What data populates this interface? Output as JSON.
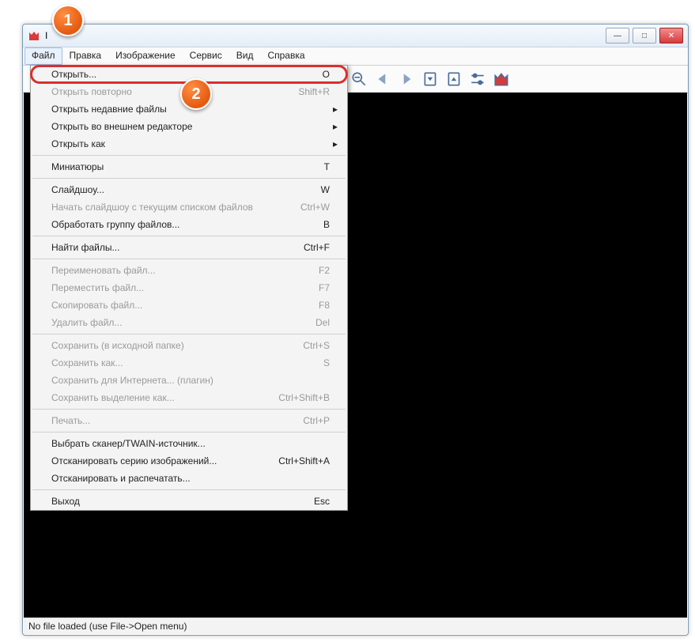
{
  "title": "I",
  "menubar": [
    "Файл",
    "Правка",
    "Изображение",
    "Сервис",
    "Вид",
    "Справка"
  ],
  "dropdown": {
    "groups": [
      [
        {
          "label": "Открыть...",
          "shortcut": "O",
          "disabled": false,
          "submenu": false,
          "highlight": true
        },
        {
          "label": "Открыть повторно",
          "shortcut": "Shift+R",
          "disabled": true,
          "submenu": false
        },
        {
          "label": "Открыть недавние файлы",
          "shortcut": "",
          "disabled": false,
          "submenu": true
        },
        {
          "label": "Открыть во внешнем редакторе",
          "shortcut": "",
          "disabled": false,
          "submenu": true
        },
        {
          "label": "Открыть как",
          "shortcut": "",
          "disabled": false,
          "submenu": true
        }
      ],
      [
        {
          "label": "Миниатюры",
          "shortcut": "T",
          "disabled": false,
          "submenu": false
        }
      ],
      [
        {
          "label": "Слайдшоу...",
          "shortcut": "W",
          "disabled": false,
          "submenu": false
        },
        {
          "label": "Начать слайдшоу с текущим списком файлов",
          "shortcut": "Ctrl+W",
          "disabled": true,
          "submenu": false
        },
        {
          "label": "Обработать группу файлов...",
          "shortcut": "B",
          "disabled": false,
          "submenu": false
        }
      ],
      [
        {
          "label": "Найти файлы...",
          "shortcut": "Ctrl+F",
          "disabled": false,
          "submenu": false
        }
      ],
      [
        {
          "label": "Переименовать файл...",
          "shortcut": "F2",
          "disabled": true,
          "submenu": false
        },
        {
          "label": "Переместить файл...",
          "shortcut": "F7",
          "disabled": true,
          "submenu": false
        },
        {
          "label": "Скопировать файл...",
          "shortcut": "F8",
          "disabled": true,
          "submenu": false
        },
        {
          "label": "Удалить файл...",
          "shortcut": "Del",
          "disabled": true,
          "submenu": false
        }
      ],
      [
        {
          "label": "Сохранить (в исходной папке)",
          "shortcut": "Ctrl+S",
          "disabled": true,
          "submenu": false
        },
        {
          "label": "Сохранить как...",
          "shortcut": "S",
          "disabled": true,
          "submenu": false
        },
        {
          "label": "Сохранить для Интернета... (плагин)",
          "shortcut": "",
          "disabled": true,
          "submenu": false
        },
        {
          "label": "Сохранить выделение как...",
          "shortcut": "Ctrl+Shift+B",
          "disabled": true,
          "submenu": false
        }
      ],
      [
        {
          "label": "Печать...",
          "shortcut": "Ctrl+P",
          "disabled": true,
          "submenu": false
        }
      ],
      [
        {
          "label": "Выбрать сканер/TWAIN-источник...",
          "shortcut": "",
          "disabled": false,
          "submenu": false
        },
        {
          "label": "Отсканировать серию изображений...",
          "shortcut": "Ctrl+Shift+A",
          "disabled": false,
          "submenu": false
        },
        {
          "label": "Отсканировать и распечатать...",
          "shortcut": "",
          "disabled": false,
          "submenu": false
        }
      ],
      [
        {
          "label": "Выход",
          "shortcut": "Esc",
          "disabled": false,
          "submenu": false
        }
      ]
    ]
  },
  "statusbar": "No file loaded (use File->Open menu)",
  "annotations": {
    "b1": "1",
    "b2": "2"
  },
  "icons": [
    "zoom-out-icon",
    "back-icon",
    "forward-icon",
    "prev-file-icon",
    "next-file-icon",
    "settings-icon",
    "app-icon"
  ]
}
